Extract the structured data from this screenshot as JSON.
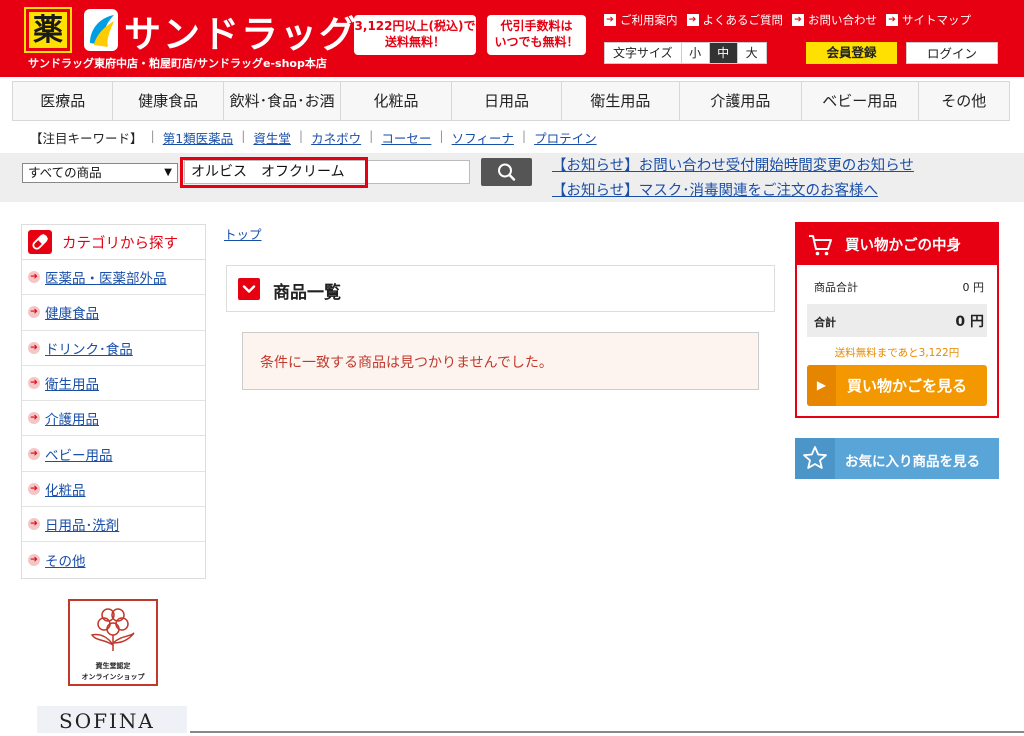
{
  "header": {
    "logo_kanji": "薬",
    "logo_text": "サンドラッグ",
    "logo_sub": "サンドラッグ東府中店・粕屋町店/サンドラッグe-shop本店",
    "promo1_line1": "3,122円以上(税込)で",
    "promo1_line2": "送料無料！",
    "promo2_line1": "代引手数料は",
    "promo2_line2": "いつでも無料！",
    "links": [
      "ご利用案内",
      "よくあるご質問",
      "お問い合わせ",
      "サイトマップ"
    ],
    "fontsize_label": "文字サイズ",
    "fontsize_options": [
      "小",
      "中",
      "大"
    ],
    "member_label": "会員登録",
    "login_label": "ログイン"
  },
  "nav": [
    "医療品",
    "健康食品",
    "飲料･食品･お酒",
    "化粧品",
    "日用品",
    "衛生用品",
    "介護用品",
    "ベビー用品",
    "その他"
  ],
  "keywords": {
    "label": "【注目キーワード】",
    "items": [
      "第1類医薬品",
      "資生堂",
      "カネボウ",
      "コーセー",
      "ソフィーナ",
      "プロテイン"
    ]
  },
  "search": {
    "category": "すべての商品",
    "query": "オルビス　オフクリーム"
  },
  "notices": [
    "【お知らせ】お問い合わせ受付開始時間変更のお知らせ",
    "【お知らせ】マスク･消毒関連をご注文のお客様へ"
  ],
  "sidebar": {
    "title": "カテゴリから探す",
    "items": [
      "医薬品・医薬部外品",
      "健康食品",
      "ドリンク･食品",
      "衛生用品",
      "介護用品",
      "ベビー用品",
      "化粧品",
      "日用品･洗剤",
      "その他"
    ]
  },
  "badge": {
    "line1": "資生堂認定",
    "line2": "オンラインショップ"
  },
  "sofina": "SOFINA",
  "main": {
    "breadcrumb": "トップ",
    "list_title": "商品一覧",
    "empty_message": "条件に一致する商品は見つかりませんでした。"
  },
  "cart": {
    "title": "買い物かごの中身",
    "subtotal_label": "商品合計",
    "subtotal_value": "0 円",
    "total_label": "合計",
    "total_value": "0 円",
    "free_shipping": "送料無料まであと3,122円",
    "view_cart": "買い物かごを見る",
    "view_favorites": "お気に入り商品を見る"
  },
  "colors": {
    "brand_red": "#e60012",
    "brand_yellow": "#ffe000",
    "cart_orange": "#f39800",
    "fav_blue": "#5aa5d8",
    "link_blue": "#1a4fa8"
  }
}
